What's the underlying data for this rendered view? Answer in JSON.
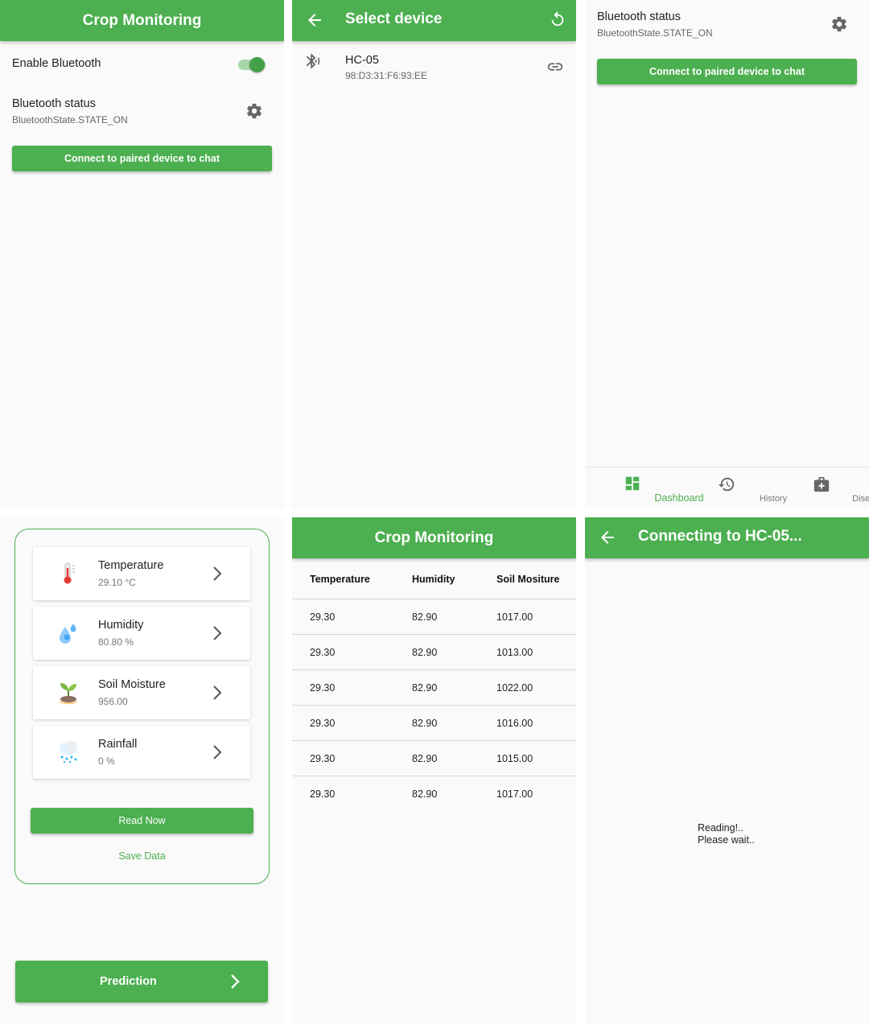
{
  "screen1": {
    "title": "Crop Monitoring",
    "enable_bluetooth_label": "Enable Bluetooth",
    "status_label": "Bluetooth status",
    "status_value": "BluetoothState.STATE_ON",
    "connect_button": "Connect to paired device to chat"
  },
  "screen2": {
    "title": "Select device",
    "device_name": "HC-05",
    "device_address": "98:D3:31:F6:93:EE"
  },
  "screen3": {
    "status_label": "Bluetooth status",
    "status_value": "BluetoothState.STATE_ON",
    "connect_button": "Connect to paired device to chat",
    "nav": [
      {
        "label": "Dashboard",
        "icon": "dashboard-icon",
        "active": true
      },
      {
        "label": "History",
        "icon": "history-icon",
        "active": false
      },
      {
        "label": "Disease",
        "icon": "medical-bag-icon",
        "active": false
      }
    ]
  },
  "screen4": {
    "cards": [
      {
        "label": "Temperature",
        "value": "29.10 °C",
        "icon": "thermometer-icon"
      },
      {
        "label": "Humidity",
        "value": "80.80 %",
        "icon": "water-drops-icon"
      },
      {
        "label": "Soil Moisture",
        "value": "956.00",
        "icon": "plant-sprout-icon"
      },
      {
        "label": "Rainfall",
        "value": "0 %",
        "icon": "rain-cloud-icon"
      }
    ],
    "read_button": "Read Now",
    "save_link": "Save Data",
    "prediction_button": "Prediction"
  },
  "screen5": {
    "title": "Crop Monitoring",
    "headers": [
      "Temperature",
      "Humidity",
      "Soil Mositure"
    ],
    "rows": [
      [
        "29.30",
        "82.90",
        "1017.00"
      ],
      [
        "29.30",
        "82.90",
        "1013.00"
      ],
      [
        "29.30",
        "82.90",
        "1022.00"
      ],
      [
        "29.30",
        "82.90",
        "1016.00"
      ],
      [
        "29.30",
        "82.90",
        "1015.00"
      ],
      [
        "29.30",
        "82.90",
        "1017.00"
      ]
    ]
  },
  "screen6": {
    "title": "Connecting to HC-05...",
    "message_line1": "Reading!..",
    "message_line2": "Please wait.."
  },
  "colors": {
    "primary": "#4caf50",
    "background": "#fafafa"
  }
}
